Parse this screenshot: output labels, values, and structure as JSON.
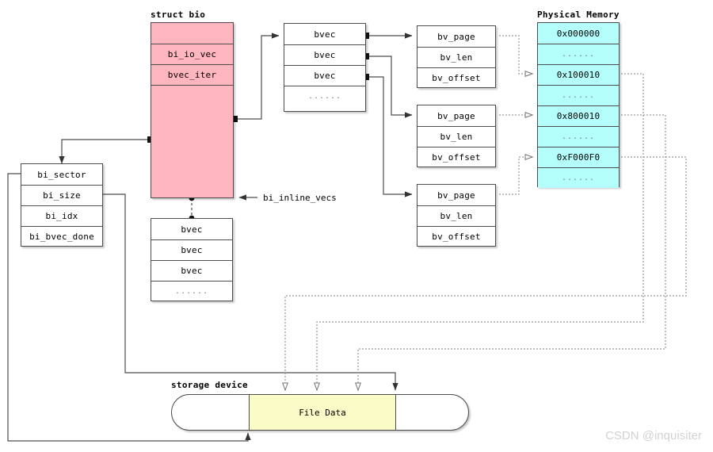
{
  "diagram": {
    "title_struct_bio": "struct bio",
    "title_physical_memory": "Physical Memory",
    "title_storage_device": "storage device",
    "label_inline_vecs": "bi_inline_vecs",
    "watermark": "CSDN @inquisiter"
  },
  "colors": {
    "bio_fill": "#ffb6be",
    "memory_fill": "#b4fffc",
    "file_data_fill": "#fbfbc8",
    "border": "#4d4d4d",
    "wire": "#4d4d4d",
    "dotted_wire": "#9a9a9a",
    "watermark": "#d2d2d2"
  },
  "bio_struct": {
    "pad_top": "",
    "fields": [
      "bi_io_vec",
      "bvec_iter"
    ],
    "pad_bottom": ""
  },
  "bvec_list_main": {
    "rows": [
      "bvec",
      "bvec",
      "bvec"
    ],
    "ellipsis": "......"
  },
  "bvec_inline_list": {
    "rows": [
      "bvec",
      "bvec",
      "bvec"
    ],
    "ellipsis": "......"
  },
  "bio_iter_fields": {
    "rows": [
      "bi_sector",
      "bi_size",
      "bi_idx",
      "bi_bvec_done"
    ]
  },
  "bio_vec_structs": [
    {
      "rows": [
        "bv_page",
        "bv_len",
        "bv_offset"
      ]
    },
    {
      "rows": [
        "bv_page",
        "bv_len",
        "bv_offset"
      ]
    },
    {
      "rows": [
        "bv_page",
        "bv_len",
        "bv_offset"
      ]
    }
  ],
  "physical_memory": {
    "rows": [
      "0x000000",
      "......",
      "0x100010",
      "......",
      "0x800010",
      "......",
      "0xF000F0",
      "......"
    ]
  },
  "storage": {
    "file_data_label": "File Data"
  }
}
